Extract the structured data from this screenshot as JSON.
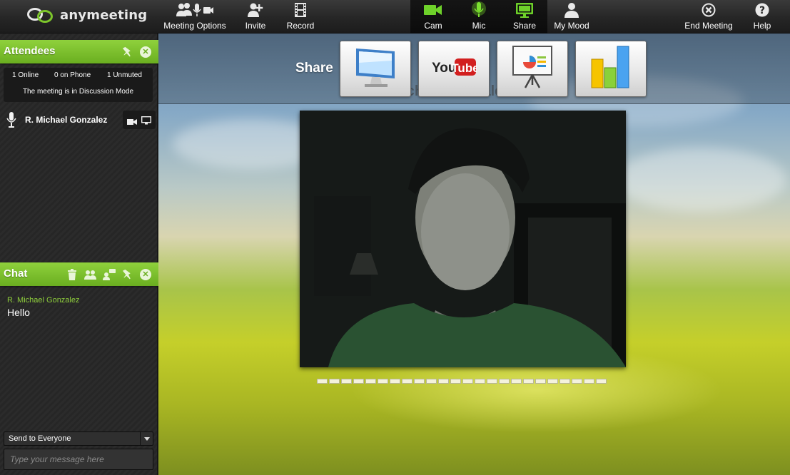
{
  "brand": {
    "name": "anymeeting"
  },
  "toolbar": {
    "meeting_options": "Meeting Options",
    "invite": "Invite",
    "record": "Record",
    "cam": "Cam",
    "mic": "Mic",
    "share": "Share",
    "my_mood": "My Mood",
    "end_meeting": "End Meeting",
    "help": "Help"
  },
  "attendees_panel": {
    "title": "Attendees",
    "online": "1 Online",
    "on_phone": "0 on Phone",
    "unmuted": "1 Unmuted",
    "mode": "The meeting is in Discussion Mode",
    "attendees": [
      {
        "name": "R. Michael Gonzalez"
      }
    ]
  },
  "chat_panel": {
    "title": "Chat",
    "messages": [
      {
        "sender": "R. Michael Gonzalez",
        "text": "Hello"
      }
    ],
    "send_to": "Send to Everyone",
    "input_placeholder": "Type your message here"
  },
  "stage": {
    "share_label": "Share",
    "share_options": [
      "screen-share",
      "youtube",
      "presentation",
      "chart"
    ],
    "youtube_text": "YouTube",
    "presenter_name": "R. Michael Gonzalez",
    "meter_segments": 24
  },
  "colors": {
    "accent_green": "#7dc62b",
    "topbar": "#262626",
    "sidebar": "#2a2a2a"
  }
}
